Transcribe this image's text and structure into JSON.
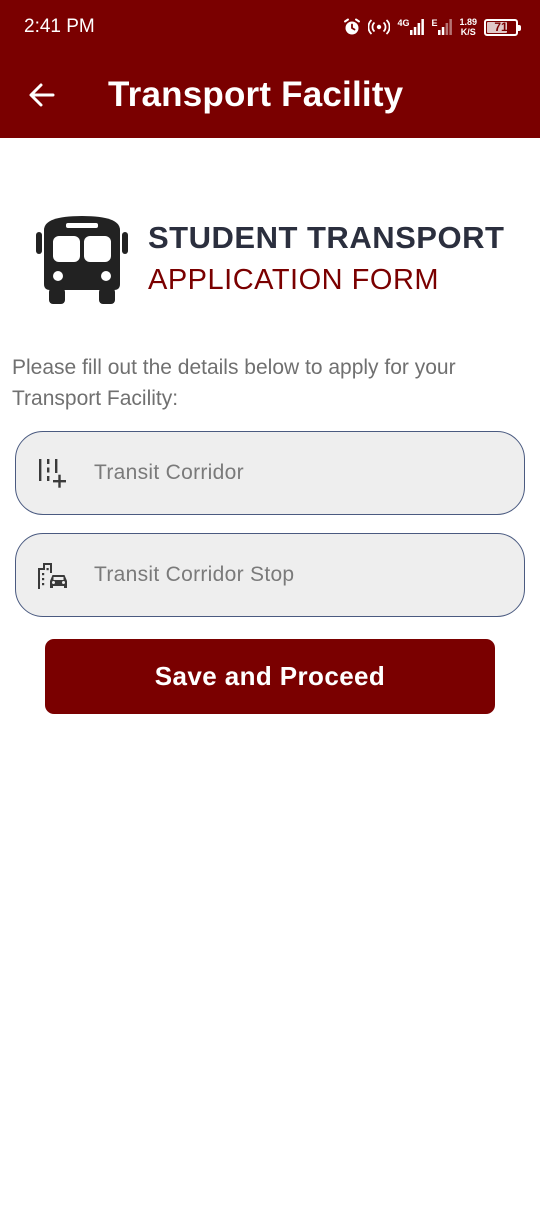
{
  "status_bar": {
    "time": "2:41 PM",
    "network_1": "4G",
    "network_2": "E",
    "speed_value": "1.89",
    "speed_unit": "K/S",
    "battery": "71",
    "battery_level_percent": 71
  },
  "app_bar": {
    "title": "Transport Facility",
    "back_icon": "arrow-left-icon"
  },
  "header": {
    "icon": "bus-icon",
    "heading_line_1": "STUDENT TRANSPORT",
    "heading_line_2": "APPLICATION FORM"
  },
  "intro_text": "Please fill out the details below to apply for your Transport Facility:",
  "form": {
    "corridor": {
      "icon": "route-add-icon",
      "value": "",
      "placeholder": "Transit Corridor"
    },
    "stop": {
      "icon": "building-car-icon",
      "value": "",
      "placeholder": "Transit Corridor Stop"
    }
  },
  "save_button_label": "Save and Proceed",
  "colors": {
    "brand": "#7a0000",
    "heading_dark": "#2b2f3e",
    "field_background": "#eeeeee",
    "field_border": "#4a5a80",
    "intro_text": "#707070"
  }
}
